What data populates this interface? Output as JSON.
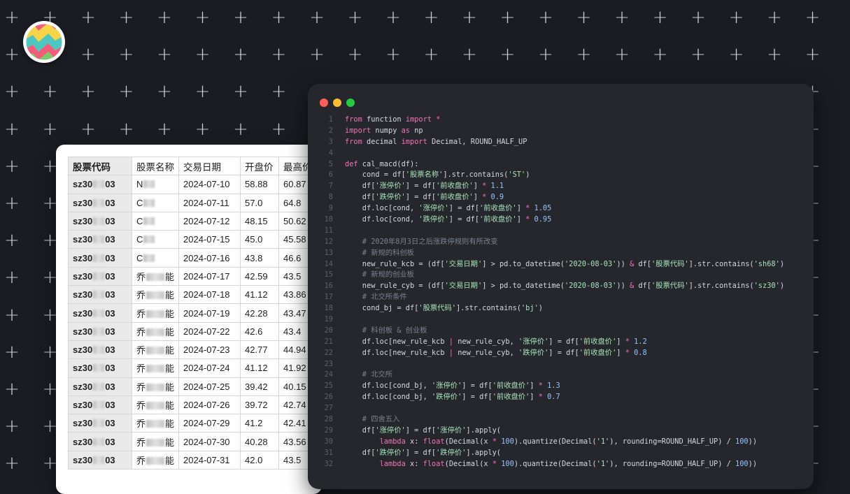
{
  "colors": {
    "background": "#1b1c22",
    "window_bg": "#25272d",
    "keyword": "#f472b6",
    "string": "#a7e3b9",
    "number": "#93c5fd",
    "comment": "#7c818c",
    "traffic_red": "#ff5f57",
    "traffic_yellow": "#febc2e",
    "traffic_green": "#28c840"
  },
  "logo": {
    "icon": "colorful-zigzag-logo"
  },
  "spreadsheet": {
    "headers": [
      "股票代码",
      "股票名称",
      "交易日期",
      "开盘价",
      "最高价"
    ],
    "rows": [
      {
        "code": "sz30▒▒03",
        "name_prefix": "N",
        "name_suffix": "",
        "date": "2024-07-10",
        "open": "58.88",
        "high": "60.87"
      },
      {
        "code": "sz30▒▒03",
        "name_prefix": "C",
        "name_suffix": "",
        "date": "2024-07-11",
        "open": "57.0",
        "high": "64.8"
      },
      {
        "code": "sz30▒▒03",
        "name_prefix": "C",
        "name_suffix": "",
        "date": "2024-07-12",
        "open": "48.15",
        "high": "50.62"
      },
      {
        "code": "sz30▒▒03",
        "name_prefix": "C",
        "name_suffix": "",
        "date": "2024-07-15",
        "open": "45.0",
        "high": "45.58"
      },
      {
        "code": "sz30▒▒03",
        "name_prefix": "C",
        "name_suffix": "",
        "date": "2024-07-16",
        "open": "43.8",
        "high": "46.6"
      },
      {
        "code": "sz30▒▒03",
        "name_prefix": "乔",
        "name_suffix": "能",
        "date": "2024-07-17",
        "open": "42.59",
        "high": "43.5"
      },
      {
        "code": "sz30▒▒03",
        "name_prefix": "乔",
        "name_suffix": "能",
        "date": "2024-07-18",
        "open": "41.12",
        "high": "43.86"
      },
      {
        "code": "sz30▒▒03",
        "name_prefix": "乔",
        "name_suffix": "能",
        "date": "2024-07-19",
        "open": "42.28",
        "high": "43.47"
      },
      {
        "code": "sz30▒▒03",
        "name_prefix": "乔",
        "name_suffix": "能",
        "date": "2024-07-22",
        "open": "42.6",
        "high": "43.4"
      },
      {
        "code": "sz30▒▒03",
        "name_prefix": "乔",
        "name_suffix": "能",
        "date": "2024-07-23",
        "open": "42.77",
        "high": "44.94"
      },
      {
        "code": "sz30▒▒03",
        "name_prefix": "乔",
        "name_suffix": "能",
        "date": "2024-07-24",
        "open": "41.12",
        "high": "41.92"
      },
      {
        "code": "sz30▒▒03",
        "name_prefix": "乔",
        "name_suffix": "能",
        "date": "2024-07-25",
        "open": "39.42",
        "high": "40.15"
      },
      {
        "code": "sz30▒▒03",
        "name_prefix": "乔",
        "name_suffix": "能",
        "date": "2024-07-26",
        "open": "39.72",
        "high": "42.74"
      },
      {
        "code": "sz30▒▒03",
        "name_prefix": "乔",
        "name_suffix": "能",
        "date": "2024-07-29",
        "open": "41.2",
        "high": "42.41"
      },
      {
        "code": "sz30▒▒03",
        "name_prefix": "乔",
        "name_suffix": "能",
        "date": "2024-07-30",
        "open": "40.28",
        "high": "43.56"
      },
      {
        "code": "sz30▒▒03",
        "name_prefix": "乔",
        "name_suffix": "能",
        "date": "2024-07-31",
        "open": "42.0",
        "high": "43.5"
      }
    ]
  },
  "code_window": {
    "lines": [
      [
        [
          "kw",
          "from"
        ],
        [
          "p",
          " function "
        ],
        [
          "kw",
          "import"
        ],
        [
          "p",
          " "
        ],
        [
          "kw",
          "*"
        ]
      ],
      [
        [
          "kw",
          "import"
        ],
        [
          "p",
          " numpy "
        ],
        [
          "kw",
          "as"
        ],
        [
          "p",
          " np"
        ]
      ],
      [
        [
          "kw",
          "from"
        ],
        [
          "p",
          " decimal "
        ],
        [
          "kw",
          "import"
        ],
        [
          "p",
          " Decimal, ROUND_HALF_UP"
        ]
      ],
      [],
      [
        [
          "kw",
          "def"
        ],
        [
          "p",
          " cal_macd(df):"
        ]
      ],
      [
        [
          "p",
          "    cond = df["
        ],
        [
          "s",
          "'股票名称'"
        ],
        [
          "p",
          "].str.contains("
        ],
        [
          "s",
          "'ST'"
        ],
        [
          "p",
          ")"
        ]
      ],
      [
        [
          "p",
          "    df["
        ],
        [
          "s",
          "'涨停价'"
        ],
        [
          "p",
          "] = df["
        ],
        [
          "s",
          "'前收盘价'"
        ],
        [
          "p",
          "] "
        ],
        [
          "kw",
          "*"
        ],
        [
          "p",
          " "
        ],
        [
          "n",
          "1.1"
        ]
      ],
      [
        [
          "p",
          "    df["
        ],
        [
          "s",
          "'跌停价'"
        ],
        [
          "p",
          "] = df["
        ],
        [
          "s",
          "'前收盘价'"
        ],
        [
          "p",
          "] "
        ],
        [
          "kw",
          "*"
        ],
        [
          "p",
          " "
        ],
        [
          "n",
          "0.9"
        ]
      ],
      [
        [
          "p",
          "    df.loc[cond, "
        ],
        [
          "s",
          "'涨停价'"
        ],
        [
          "p",
          "] = df["
        ],
        [
          "s",
          "'前收盘价'"
        ],
        [
          "p",
          "] "
        ],
        [
          "kw",
          "*"
        ],
        [
          "p",
          " "
        ],
        [
          "n",
          "1.05"
        ]
      ],
      [
        [
          "p",
          "    df.loc[cond, "
        ],
        [
          "s",
          "'跌停价'"
        ],
        [
          "p",
          "] = df["
        ],
        [
          "s",
          "'前收盘价'"
        ],
        [
          "p",
          "] "
        ],
        [
          "kw",
          "*"
        ],
        [
          "p",
          " "
        ],
        [
          "n",
          "0.95"
        ]
      ],
      [],
      [
        [
          "c",
          "    # 2020年8月3日之后涨跌停规则有所改变"
        ]
      ],
      [
        [
          "c",
          "    # 新规的科创板"
        ]
      ],
      [
        [
          "p",
          "    new_rule_kcb = (df["
        ],
        [
          "s",
          "'交易日期'"
        ],
        [
          "p",
          "] > pd.to_datetime("
        ],
        [
          "s",
          "'2020-08-03'"
        ],
        [
          "p",
          ")) "
        ],
        [
          "kw",
          "&"
        ],
        [
          "p",
          " df["
        ],
        [
          "s",
          "'股票代码'"
        ],
        [
          "p",
          "].str.contains("
        ],
        [
          "s",
          "'sh68'"
        ],
        [
          "p",
          ")"
        ]
      ],
      [
        [
          "c",
          "    # 新规的创业板"
        ]
      ],
      [
        [
          "p",
          "    new_rule_cyb = (df["
        ],
        [
          "s",
          "'交易日期'"
        ],
        [
          "p",
          "] > pd.to_datetime("
        ],
        [
          "s",
          "'2020-08-03'"
        ],
        [
          "p",
          ")) "
        ],
        [
          "kw",
          "&"
        ],
        [
          "p",
          " df["
        ],
        [
          "s",
          "'股票代码'"
        ],
        [
          "p",
          "].str.contains("
        ],
        [
          "s",
          "'sz30'"
        ],
        [
          "p",
          ")"
        ]
      ],
      [
        [
          "c",
          "    # 北交所条件"
        ]
      ],
      [
        [
          "p",
          "    cond_bj = df["
        ],
        [
          "s",
          "'股票代码'"
        ],
        [
          "p",
          "].str.contains("
        ],
        [
          "s",
          "'bj'"
        ],
        [
          "p",
          ")"
        ]
      ],
      [],
      [
        [
          "c",
          "    # 科创板 & 创业板"
        ]
      ],
      [
        [
          "p",
          "    df.loc[new_rule_kcb "
        ],
        [
          "kw",
          "|"
        ],
        [
          "p",
          " new_rule_cyb, "
        ],
        [
          "s",
          "'涨停价'"
        ],
        [
          "p",
          "] = df["
        ],
        [
          "s",
          "'前收盘价'"
        ],
        [
          "p",
          "] "
        ],
        [
          "kw",
          "*"
        ],
        [
          "p",
          " "
        ],
        [
          "n",
          "1.2"
        ]
      ],
      [
        [
          "p",
          "    df.loc[new_rule_kcb "
        ],
        [
          "kw",
          "|"
        ],
        [
          "p",
          " new_rule_cyb, "
        ],
        [
          "s",
          "'跌停价'"
        ],
        [
          "p",
          "] = df["
        ],
        [
          "s",
          "'前收盘价'"
        ],
        [
          "p",
          "] "
        ],
        [
          "kw",
          "*"
        ],
        [
          "p",
          " "
        ],
        [
          "n",
          "0.8"
        ]
      ],
      [],
      [
        [
          "c",
          "    # 北交所"
        ]
      ],
      [
        [
          "p",
          "    df.loc[cond_bj, "
        ],
        [
          "s",
          "'涨停价'"
        ],
        [
          "p",
          "] = df["
        ],
        [
          "s",
          "'前收盘价'"
        ],
        [
          "p",
          "] "
        ],
        [
          "kw",
          "*"
        ],
        [
          "p",
          " "
        ],
        [
          "n",
          "1.3"
        ]
      ],
      [
        [
          "p",
          "    df.loc[cond_bj, "
        ],
        [
          "s",
          "'跌停价'"
        ],
        [
          "p",
          "] = df["
        ],
        [
          "s",
          "'前收盘价'"
        ],
        [
          "p",
          "] "
        ],
        [
          "kw",
          "*"
        ],
        [
          "p",
          " "
        ],
        [
          "n",
          "0.7"
        ]
      ],
      [],
      [
        [
          "c",
          "    # 四舍五入"
        ]
      ],
      [
        [
          "p",
          "    df["
        ],
        [
          "s",
          "'涨停价'"
        ],
        [
          "p",
          "] = df["
        ],
        [
          "s",
          "'涨停价'"
        ],
        [
          "p",
          "].apply("
        ]
      ],
      [
        [
          "p",
          "        "
        ],
        [
          "kw",
          "lambda"
        ],
        [
          "p",
          " x: "
        ],
        [
          "kw",
          "float"
        ],
        [
          "p",
          "(Decimal(x "
        ],
        [
          "kw",
          "*"
        ],
        [
          "p",
          " "
        ],
        [
          "n",
          "100"
        ],
        [
          "p",
          ").quantize(Decimal("
        ],
        [
          "s",
          "'1'"
        ],
        [
          "p",
          "), rounding=ROUND_HALF_UP) / "
        ],
        [
          "n",
          "100"
        ],
        [
          "p",
          "))"
        ]
      ],
      [
        [
          "p",
          "    df["
        ],
        [
          "s",
          "'跌停价'"
        ],
        [
          "p",
          "] = df["
        ],
        [
          "s",
          "'跌停价'"
        ],
        [
          "p",
          "].apply("
        ]
      ],
      [
        [
          "p",
          "        "
        ],
        [
          "kw",
          "lambda"
        ],
        [
          "p",
          " x: "
        ],
        [
          "kw",
          "float"
        ],
        [
          "p",
          "(Decimal(x "
        ],
        [
          "kw",
          "*"
        ],
        [
          "p",
          " "
        ],
        [
          "n",
          "100"
        ],
        [
          "p",
          ").quantize(Decimal("
        ],
        [
          "s",
          "'1'"
        ],
        [
          "p",
          "), rounding=ROUND_HALF_UP) / "
        ],
        [
          "n",
          "100"
        ],
        [
          "p",
          "))"
        ]
      ]
    ]
  }
}
